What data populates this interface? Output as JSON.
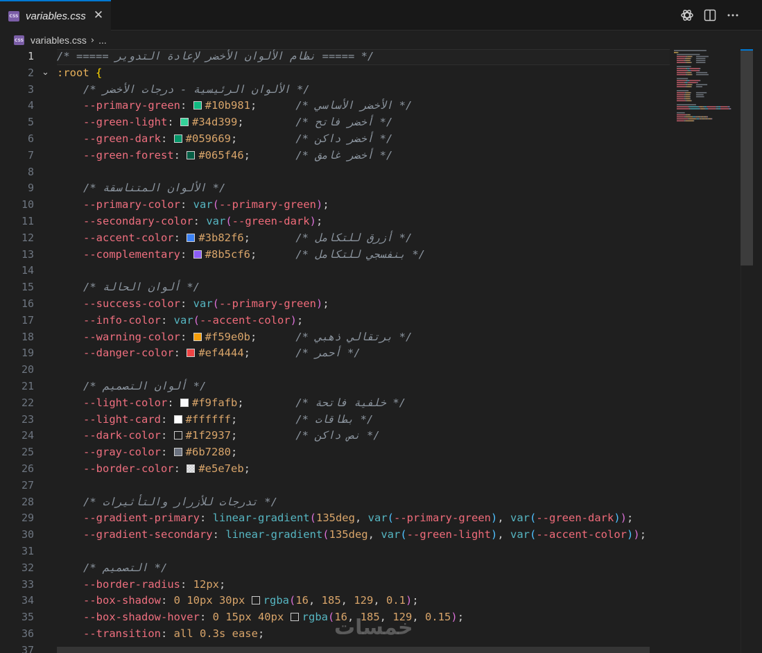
{
  "tab": {
    "icon_text": "CSS",
    "filename": "variables.css",
    "close_glyph": "✕"
  },
  "toolbar": {
    "icons": [
      "openai-icon",
      "split-editor-icon",
      "more-actions-icon"
    ]
  },
  "breadcrumb": {
    "icon_text": "CSS",
    "file": "variables.css",
    "separator": "›",
    "ellipsis": "..."
  },
  "editor": {
    "active_line": 1,
    "lines": [
      [
        {
          "t": "c",
          "v": "/* ===== نظام الألوان الأخضر لإعادة التدوير ===== */"
        }
      ],
      [
        {
          "t": "sel",
          "v": ":root"
        },
        {
          "t": "p",
          "v": " "
        },
        {
          "t": "brace",
          "v": "{"
        }
      ],
      [
        {
          "t": "c",
          "v": "/* الألوان الرئيسية - درجات الأخضر */"
        }
      ],
      [
        {
          "t": "prop",
          "v": "--primary-green"
        },
        {
          "t": "p",
          "v": ": "
        },
        {
          "t": "sw",
          "v": "#10b981"
        },
        {
          "t": "hex",
          "v": "#10b981"
        },
        {
          "t": "p",
          "v": ";"
        },
        {
          "t": "pad",
          "v": 6
        },
        {
          "t": "c",
          "v": "/* الأخضر الأساسي */"
        }
      ],
      [
        {
          "t": "prop",
          "v": "--green-light"
        },
        {
          "t": "p",
          "v": ": "
        },
        {
          "t": "sw",
          "v": "#34d399"
        },
        {
          "t": "hex",
          "v": "#34d399"
        },
        {
          "t": "p",
          "v": ";"
        },
        {
          "t": "pad",
          "v": 8
        },
        {
          "t": "c",
          "v": "/* أخضر فاتح */"
        }
      ],
      [
        {
          "t": "prop",
          "v": "--green-dark"
        },
        {
          "t": "p",
          "v": ": "
        },
        {
          "t": "sw",
          "v": "#059669"
        },
        {
          "t": "hex",
          "v": "#059669"
        },
        {
          "t": "p",
          "v": ";"
        },
        {
          "t": "pad",
          "v": 9
        },
        {
          "t": "c",
          "v": "/* أخضر داكن */"
        }
      ],
      [
        {
          "t": "prop",
          "v": "--green-forest"
        },
        {
          "t": "p",
          "v": ": "
        },
        {
          "t": "sw",
          "v": "#065f46"
        },
        {
          "t": "hex",
          "v": "#065f46"
        },
        {
          "t": "p",
          "v": ";"
        },
        {
          "t": "pad",
          "v": 7
        },
        {
          "t": "c",
          "v": "/* أخضر غامق */"
        }
      ],
      [],
      [
        {
          "t": "c",
          "v": "/* الألوان المتناسقة */"
        }
      ],
      [
        {
          "t": "prop",
          "v": "--primary-color"
        },
        {
          "t": "p",
          "v": ": "
        },
        {
          "t": "fn",
          "v": "var"
        },
        {
          "t": "paren",
          "v": "("
        },
        {
          "t": "var",
          "v": "--primary-green"
        },
        {
          "t": "paren",
          "v": ")"
        },
        {
          "t": "p",
          "v": ";"
        }
      ],
      [
        {
          "t": "prop",
          "v": "--secondary-color"
        },
        {
          "t": "p",
          "v": ": "
        },
        {
          "t": "fn",
          "v": "var"
        },
        {
          "t": "paren",
          "v": "("
        },
        {
          "t": "var",
          "v": "--green-dark"
        },
        {
          "t": "paren",
          "v": ")"
        },
        {
          "t": "p",
          "v": ";"
        }
      ],
      [
        {
          "t": "prop",
          "v": "--accent-color"
        },
        {
          "t": "p",
          "v": ": "
        },
        {
          "t": "sw",
          "v": "#3b82f6"
        },
        {
          "t": "hex",
          "v": "#3b82f6"
        },
        {
          "t": "p",
          "v": ";"
        },
        {
          "t": "pad",
          "v": 7
        },
        {
          "t": "c",
          "v": "/* أزرق للتكامل */"
        }
      ],
      [
        {
          "t": "prop",
          "v": "--complementary"
        },
        {
          "t": "p",
          "v": ": "
        },
        {
          "t": "sw",
          "v": "#8b5cf6"
        },
        {
          "t": "hex",
          "v": "#8b5cf6"
        },
        {
          "t": "p",
          "v": ";"
        },
        {
          "t": "pad",
          "v": 6
        },
        {
          "t": "c",
          "v": "/* بنفسجي للتكامل */"
        }
      ],
      [],
      [
        {
          "t": "c",
          "v": "/* ألوان الحالة */"
        }
      ],
      [
        {
          "t": "prop",
          "v": "--success-color"
        },
        {
          "t": "p",
          "v": ": "
        },
        {
          "t": "fn",
          "v": "var"
        },
        {
          "t": "paren",
          "v": "("
        },
        {
          "t": "var",
          "v": "--primary-green"
        },
        {
          "t": "paren",
          "v": ")"
        },
        {
          "t": "p",
          "v": ";"
        }
      ],
      [
        {
          "t": "prop",
          "v": "--info-color"
        },
        {
          "t": "p",
          "v": ": "
        },
        {
          "t": "fn",
          "v": "var"
        },
        {
          "t": "paren",
          "v": "("
        },
        {
          "t": "var",
          "v": "--accent-color"
        },
        {
          "t": "paren",
          "v": ")"
        },
        {
          "t": "p",
          "v": ";"
        }
      ],
      [
        {
          "t": "prop",
          "v": "--warning-color"
        },
        {
          "t": "p",
          "v": ": "
        },
        {
          "t": "sw",
          "v": "#f59e0b"
        },
        {
          "t": "hex",
          "v": "#f59e0b"
        },
        {
          "t": "p",
          "v": ";"
        },
        {
          "t": "pad",
          "v": 6
        },
        {
          "t": "c",
          "v": "/* برتقالي ذهبي */"
        }
      ],
      [
        {
          "t": "prop",
          "v": "--danger-color"
        },
        {
          "t": "p",
          "v": ": "
        },
        {
          "t": "sw",
          "v": "#ef4444"
        },
        {
          "t": "hex",
          "v": "#ef4444"
        },
        {
          "t": "p",
          "v": ";"
        },
        {
          "t": "pad",
          "v": 7
        },
        {
          "t": "c",
          "v": "/* أحمر */"
        }
      ],
      [],
      [
        {
          "t": "c",
          "v": "/* ألوان التصميم */"
        }
      ],
      [
        {
          "t": "prop",
          "v": "--light-color"
        },
        {
          "t": "p",
          "v": ": "
        },
        {
          "t": "sw",
          "v": "#f9fafb"
        },
        {
          "t": "hex",
          "v": "#f9fafb"
        },
        {
          "t": "p",
          "v": ";"
        },
        {
          "t": "pad",
          "v": 8
        },
        {
          "t": "c",
          "v": "/* خلفية فاتحة */"
        }
      ],
      [
        {
          "t": "prop",
          "v": "--light-card"
        },
        {
          "t": "p",
          "v": ": "
        },
        {
          "t": "sw",
          "v": "#ffffff"
        },
        {
          "t": "hex",
          "v": "#ffffff"
        },
        {
          "t": "p",
          "v": ";"
        },
        {
          "t": "pad",
          "v": 9
        },
        {
          "t": "c",
          "v": "/* بطاقات */"
        }
      ],
      [
        {
          "t": "prop",
          "v": "--dark-color"
        },
        {
          "t": "p",
          "v": ": "
        },
        {
          "t": "swo",
          "v": "#1f2937"
        },
        {
          "t": "hex",
          "v": "#1f2937"
        },
        {
          "t": "p",
          "v": ";"
        },
        {
          "t": "pad",
          "v": 9
        },
        {
          "t": "c",
          "v": "/* نص داكن */"
        }
      ],
      [
        {
          "t": "prop",
          "v": "--gray-color"
        },
        {
          "t": "p",
          "v": ": "
        },
        {
          "t": "sw",
          "v": "#6b7280"
        },
        {
          "t": "hex",
          "v": "#6b7280"
        },
        {
          "t": "p",
          "v": ";"
        }
      ],
      [
        {
          "t": "prop",
          "v": "--border-color"
        },
        {
          "t": "p",
          "v": ": "
        },
        {
          "t": "swc",
          "v": "#e5e7eb"
        },
        {
          "t": "hex",
          "v": "#e5e7eb"
        },
        {
          "t": "p",
          "v": ";"
        }
      ],
      [],
      [
        {
          "t": "c",
          "v": "/* تدرجات للأزرار والتأثيرات */"
        }
      ],
      [
        {
          "t": "prop",
          "v": "--gradient-primary"
        },
        {
          "t": "p",
          "v": ": "
        },
        {
          "t": "fn",
          "v": "linear-gradient"
        },
        {
          "t": "paren",
          "v": "("
        },
        {
          "t": "num",
          "v": "135deg"
        },
        {
          "t": "p",
          "v": ", "
        },
        {
          "t": "fn",
          "v": "var"
        },
        {
          "t": "paren2",
          "v": "("
        },
        {
          "t": "var",
          "v": "--primary-green"
        },
        {
          "t": "paren2",
          "v": ")"
        },
        {
          "t": "p",
          "v": ", "
        },
        {
          "t": "fn",
          "v": "var"
        },
        {
          "t": "paren2",
          "v": "("
        },
        {
          "t": "var",
          "v": "--green-dark"
        },
        {
          "t": "paren2",
          "v": ")"
        },
        {
          "t": "paren",
          "v": ")"
        },
        {
          "t": "p",
          "v": ";"
        }
      ],
      [
        {
          "t": "prop",
          "v": "--gradient-secondary"
        },
        {
          "t": "p",
          "v": ": "
        },
        {
          "t": "fn",
          "v": "linear-gradient"
        },
        {
          "t": "paren",
          "v": "("
        },
        {
          "t": "num",
          "v": "135deg"
        },
        {
          "t": "p",
          "v": ", "
        },
        {
          "t": "fn",
          "v": "var"
        },
        {
          "t": "paren2",
          "v": "("
        },
        {
          "t": "var",
          "v": "--green-light"
        },
        {
          "t": "paren2",
          "v": ")"
        },
        {
          "t": "p",
          "v": ", "
        },
        {
          "t": "fn",
          "v": "var"
        },
        {
          "t": "paren2",
          "v": "("
        },
        {
          "t": "var",
          "v": "--accent-color"
        },
        {
          "t": "paren2",
          "v": ")"
        },
        {
          "t": "paren",
          "v": ")"
        },
        {
          "t": "p",
          "v": ";"
        }
      ],
      [],
      [
        {
          "t": "c",
          "v": "/* التصميم */"
        }
      ],
      [
        {
          "t": "prop",
          "v": "--border-radius"
        },
        {
          "t": "p",
          "v": ": "
        },
        {
          "t": "num",
          "v": "12px"
        },
        {
          "t": "p",
          "v": ";"
        }
      ],
      [
        {
          "t": "prop",
          "v": "--box-shadow"
        },
        {
          "t": "p",
          "v": ": "
        },
        {
          "t": "num",
          "v": "0 10px 30px"
        },
        {
          "t": "p",
          "v": " "
        },
        {
          "t": "swo",
          "v": "rgba(16,185,129,0.1)"
        },
        {
          "t": "fn",
          "v": "rgba"
        },
        {
          "t": "paren",
          "v": "("
        },
        {
          "t": "num",
          "v": "16"
        },
        {
          "t": "p",
          "v": ", "
        },
        {
          "t": "num",
          "v": "185"
        },
        {
          "t": "p",
          "v": ", "
        },
        {
          "t": "num",
          "v": "129"
        },
        {
          "t": "p",
          "v": ", "
        },
        {
          "t": "num",
          "v": "0.1"
        },
        {
          "t": "paren",
          "v": ")"
        },
        {
          "t": "p",
          "v": ";"
        }
      ],
      [
        {
          "t": "prop",
          "v": "--box-shadow-hover"
        },
        {
          "t": "p",
          "v": ": "
        },
        {
          "t": "num",
          "v": "0 15px 40px"
        },
        {
          "t": "p",
          "v": " "
        },
        {
          "t": "swo",
          "v": "rgba(16,185,129,0.15)"
        },
        {
          "t": "fn",
          "v": "rgba"
        },
        {
          "t": "paren",
          "v": "("
        },
        {
          "t": "num",
          "v": "16"
        },
        {
          "t": "p",
          "v": ", "
        },
        {
          "t": "num",
          "v": "185"
        },
        {
          "t": "p",
          "v": ", "
        },
        {
          "t": "num",
          "v": "129"
        },
        {
          "t": "p",
          "v": ", "
        },
        {
          "t": "num",
          "v": "0.15"
        },
        {
          "t": "paren",
          "v": ")"
        },
        {
          "t": "p",
          "v": ";"
        }
      ],
      [
        {
          "t": "prop",
          "v": "--transition"
        },
        {
          "t": "p",
          "v": ": "
        },
        {
          "t": "kw",
          "v": "all 0.3s ease"
        },
        {
          "t": "p",
          "v": ";"
        }
      ],
      []
    ]
  },
  "watermark": "خمسات",
  "colors": {
    "accent": "#0078d4",
    "editor_bg": "#1f1f1f"
  }
}
